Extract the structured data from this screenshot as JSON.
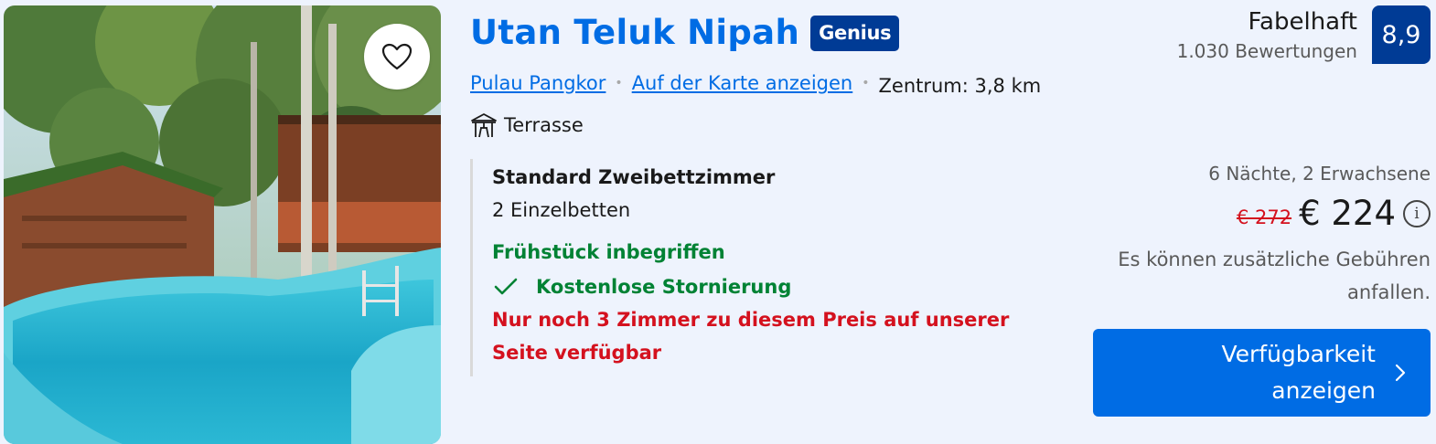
{
  "listing": {
    "name": "Utan Teluk Nipah",
    "badge": "Genius",
    "location": "Pulau Pangkor",
    "map_link": "Auf der Karte anzeigen",
    "distance": "Zentrum: 3,8 km",
    "facility": "Terrasse",
    "photo_icon": "favorite-heart-icon"
  },
  "review": {
    "word": "Fabelhaft",
    "count": "1.030 Bewertungen",
    "score": "8,9"
  },
  "room": {
    "name": "Standard Zweibettzimmer",
    "beds": "2 Einzelbetten",
    "breakfast": "Frühstück inbegriffen",
    "cancellation": "Kostenlose Stornierung",
    "scarcity": "Nur noch 3 Zimmer zu diesem Preis auf unserer Seite verfügbar"
  },
  "price": {
    "stay": "6 Nächte, 2 Erwachsene",
    "old": "€ 272",
    "current": "€ 224",
    "info": "i",
    "fees": "Es können zusätzliche Gebühren anfallen."
  },
  "cta": {
    "label": "Verfügbarkeit anzeigen"
  },
  "colors": {
    "brand_blue": "#006ce4",
    "dark_blue": "#003b95",
    "green": "#008234",
    "red": "#d4111e",
    "background": "#eef3fd"
  }
}
